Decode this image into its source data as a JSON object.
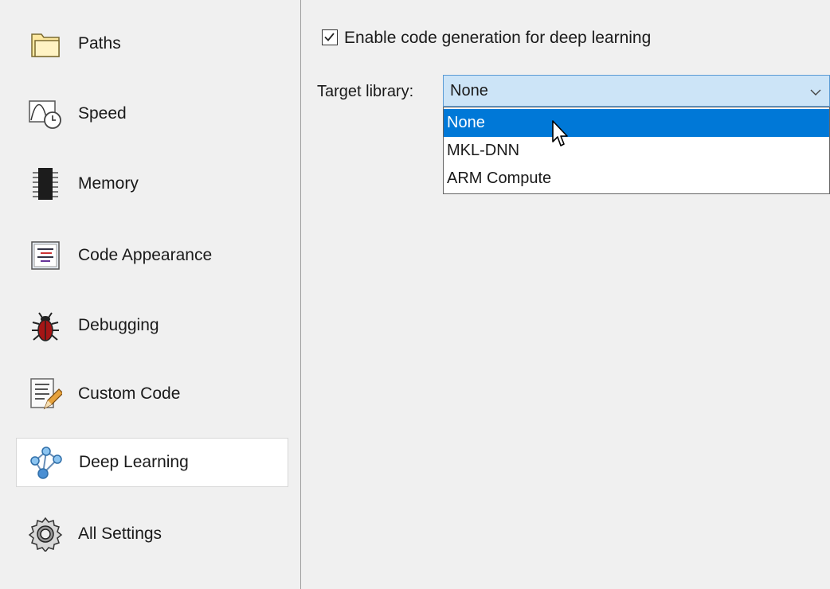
{
  "sidebar": {
    "items": [
      {
        "label": "Paths",
        "icon": "folder-icon"
      },
      {
        "label": "Speed",
        "icon": "speed-clock-icon"
      },
      {
        "label": "Memory",
        "icon": "memory-chip-icon"
      },
      {
        "label": "Code Appearance",
        "icon": "code-appearance-icon"
      },
      {
        "label": "Debugging",
        "icon": "bug-icon"
      },
      {
        "label": "Custom Code",
        "icon": "custom-code-icon"
      },
      {
        "label": "Deep Learning",
        "icon": "network-icon",
        "selected": true
      },
      {
        "label": "All Settings",
        "icon": "gear-icon"
      }
    ]
  },
  "main": {
    "enable_checkbox": {
      "label": "Enable code generation for deep learning",
      "checked": true
    },
    "target_library": {
      "label": "Target library:",
      "selected": "None",
      "options": [
        "None",
        "MKL-DNN",
        "ARM Compute"
      ],
      "highlighted_index": 0
    }
  },
  "colors": {
    "highlight": "#0078d7",
    "select_bg": "#cce4f7",
    "select_border": "#5a9bd5"
  }
}
